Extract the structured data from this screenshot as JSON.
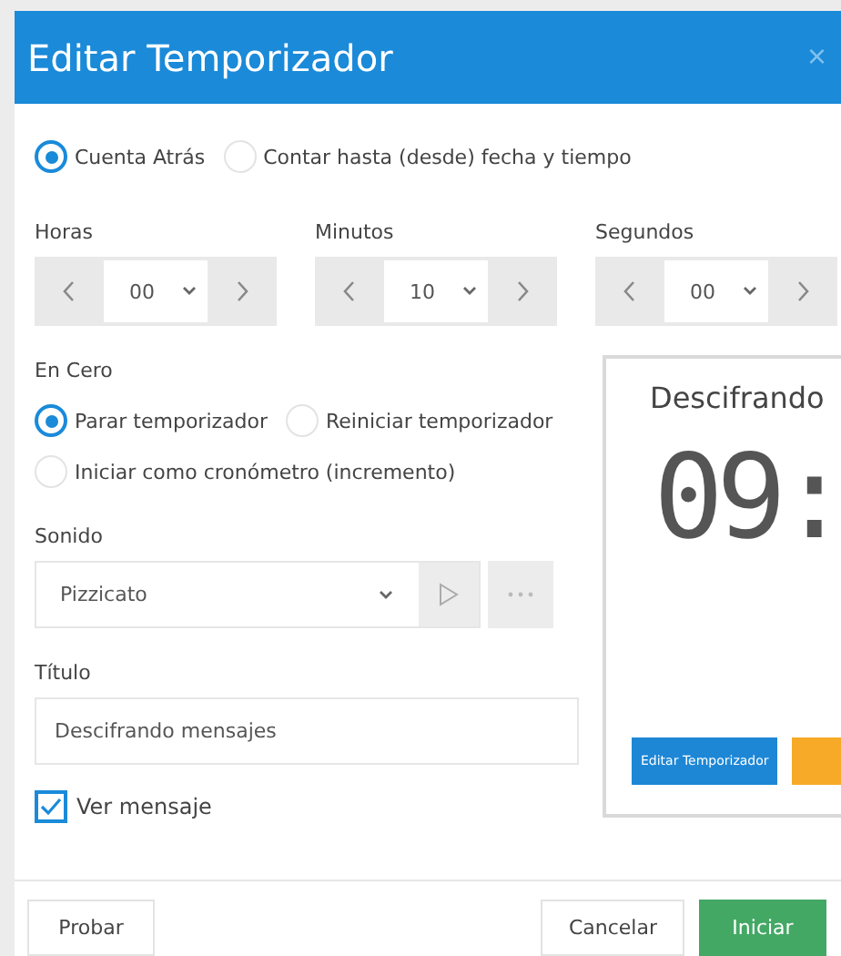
{
  "dialog": {
    "title": "Editar Temporizador",
    "close": "×"
  },
  "mode_options": [
    {
      "label": "Cuenta Atrás",
      "selected": true
    },
    {
      "label": "Contar hasta (desde) fecha y tiempo",
      "selected": false
    }
  ],
  "time_fields": [
    {
      "label": "Horas",
      "value": "00"
    },
    {
      "label": "Minutos",
      "value": "10"
    },
    {
      "label": "Segundos",
      "value": "00"
    }
  ],
  "at_zero": {
    "label": "En Cero",
    "options": [
      {
        "label": "Parar temporizador",
        "selected": true
      },
      {
        "label": "Reiniciar temporizador",
        "selected": false
      },
      {
        "label": "Iniciar como cronómetro (incremento)",
        "selected": false
      }
    ]
  },
  "sound": {
    "label": "Sonido",
    "value": "Pizzicato"
  },
  "title_field": {
    "label": "Título",
    "value": "Descifrando mensajes"
  },
  "show_message": {
    "label": "Ver mensaje",
    "checked": true
  },
  "preview": {
    "title": "Descifrando",
    "display": "09:",
    "buttons": [
      {
        "label": "Editar Temporizador",
        "color": "#1d87d6"
      },
      {
        "color": "#f7a928"
      }
    ]
  },
  "footer": {
    "left_buttons": [
      {
        "label": "Probar",
        "kind": "default"
      }
    ],
    "right_buttons": [
      {
        "label": "Cancelar",
        "kind": "default"
      },
      {
        "label": "Iniciar",
        "kind": "primary"
      }
    ]
  }
}
